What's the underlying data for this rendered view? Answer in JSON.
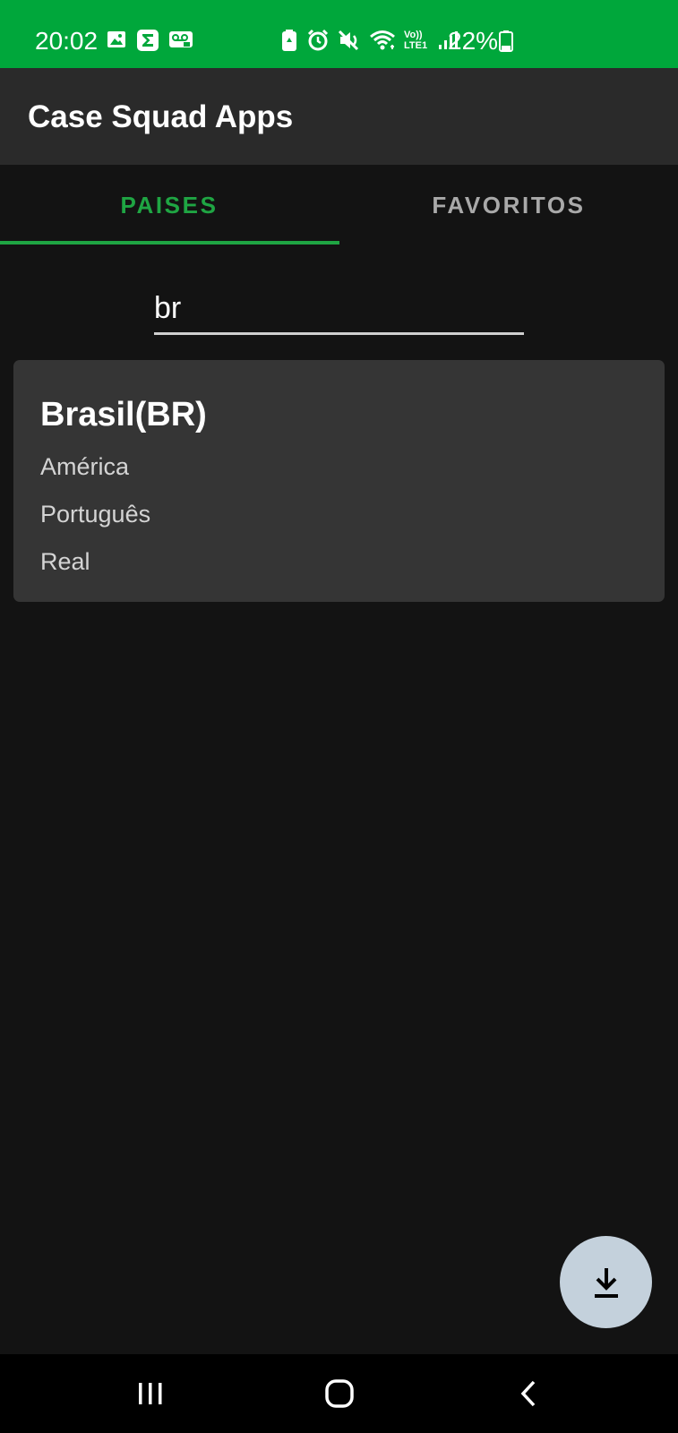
{
  "status_bar": {
    "time": "20:02",
    "battery_percent": "22%",
    "left_icons": [
      "gallery-icon",
      "sigma-app-icon",
      "voicemail-icon"
    ],
    "right_icons": [
      "battery-saver-icon",
      "alarm-icon",
      "mute-icon",
      "wifi-icon",
      "volte-icon",
      "signal-icon"
    ],
    "volte_label": "Vo)) LTE1",
    "accent_color": "#00a73b"
  },
  "app_bar": {
    "title": "Case Squad Apps"
  },
  "tabs": [
    {
      "label": "PAISES",
      "selected": true
    },
    {
      "label": "FAVORITOS",
      "selected": false
    }
  ],
  "search": {
    "value": "br"
  },
  "results": [
    {
      "name": "Brasil(BR)",
      "region": "América",
      "language": "Português",
      "currency": "Real"
    }
  ],
  "fab": {
    "icon": "download-icon"
  },
  "nav_bar": {
    "buttons": [
      "recents-icon",
      "home-icon",
      "back-icon"
    ]
  },
  "colors": {
    "tab_selected": "#1fa543",
    "tab_unselected": "#a9a9a9",
    "background": "#131313",
    "card": "#353535",
    "fab": "#c4d1dc"
  }
}
